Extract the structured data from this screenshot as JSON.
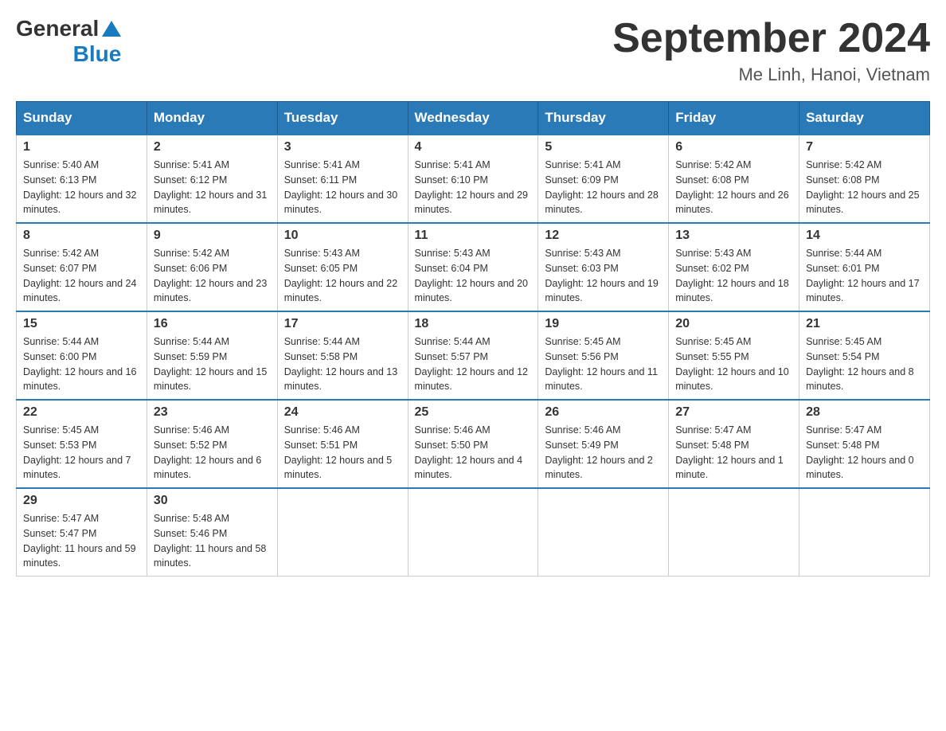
{
  "header": {
    "logo_general": "General",
    "logo_blue": "Blue",
    "month_title": "September 2024",
    "location": "Me Linh, Hanoi, Vietnam"
  },
  "days_of_week": [
    "Sunday",
    "Monday",
    "Tuesday",
    "Wednesday",
    "Thursday",
    "Friday",
    "Saturday"
  ],
  "weeks": [
    [
      {
        "day": "1",
        "sunrise": "5:40 AM",
        "sunset": "6:13 PM",
        "daylight": "12 hours and 32 minutes."
      },
      {
        "day": "2",
        "sunrise": "5:41 AM",
        "sunset": "6:12 PM",
        "daylight": "12 hours and 31 minutes."
      },
      {
        "day": "3",
        "sunrise": "5:41 AM",
        "sunset": "6:11 PM",
        "daylight": "12 hours and 30 minutes."
      },
      {
        "day": "4",
        "sunrise": "5:41 AM",
        "sunset": "6:10 PM",
        "daylight": "12 hours and 29 minutes."
      },
      {
        "day": "5",
        "sunrise": "5:41 AM",
        "sunset": "6:09 PM",
        "daylight": "12 hours and 28 minutes."
      },
      {
        "day": "6",
        "sunrise": "5:42 AM",
        "sunset": "6:08 PM",
        "daylight": "12 hours and 26 minutes."
      },
      {
        "day": "7",
        "sunrise": "5:42 AM",
        "sunset": "6:08 PM",
        "daylight": "12 hours and 25 minutes."
      }
    ],
    [
      {
        "day": "8",
        "sunrise": "5:42 AM",
        "sunset": "6:07 PM",
        "daylight": "12 hours and 24 minutes."
      },
      {
        "day": "9",
        "sunrise": "5:42 AM",
        "sunset": "6:06 PM",
        "daylight": "12 hours and 23 minutes."
      },
      {
        "day": "10",
        "sunrise": "5:43 AM",
        "sunset": "6:05 PM",
        "daylight": "12 hours and 22 minutes."
      },
      {
        "day": "11",
        "sunrise": "5:43 AM",
        "sunset": "6:04 PM",
        "daylight": "12 hours and 20 minutes."
      },
      {
        "day": "12",
        "sunrise": "5:43 AM",
        "sunset": "6:03 PM",
        "daylight": "12 hours and 19 minutes."
      },
      {
        "day": "13",
        "sunrise": "5:43 AM",
        "sunset": "6:02 PM",
        "daylight": "12 hours and 18 minutes."
      },
      {
        "day": "14",
        "sunrise": "5:44 AM",
        "sunset": "6:01 PM",
        "daylight": "12 hours and 17 minutes."
      }
    ],
    [
      {
        "day": "15",
        "sunrise": "5:44 AM",
        "sunset": "6:00 PM",
        "daylight": "12 hours and 16 minutes."
      },
      {
        "day": "16",
        "sunrise": "5:44 AM",
        "sunset": "5:59 PM",
        "daylight": "12 hours and 15 minutes."
      },
      {
        "day": "17",
        "sunrise": "5:44 AM",
        "sunset": "5:58 PM",
        "daylight": "12 hours and 13 minutes."
      },
      {
        "day": "18",
        "sunrise": "5:44 AM",
        "sunset": "5:57 PM",
        "daylight": "12 hours and 12 minutes."
      },
      {
        "day": "19",
        "sunrise": "5:45 AM",
        "sunset": "5:56 PM",
        "daylight": "12 hours and 11 minutes."
      },
      {
        "day": "20",
        "sunrise": "5:45 AM",
        "sunset": "5:55 PM",
        "daylight": "12 hours and 10 minutes."
      },
      {
        "day": "21",
        "sunrise": "5:45 AM",
        "sunset": "5:54 PM",
        "daylight": "12 hours and 8 minutes."
      }
    ],
    [
      {
        "day": "22",
        "sunrise": "5:45 AM",
        "sunset": "5:53 PM",
        "daylight": "12 hours and 7 minutes."
      },
      {
        "day": "23",
        "sunrise": "5:46 AM",
        "sunset": "5:52 PM",
        "daylight": "12 hours and 6 minutes."
      },
      {
        "day": "24",
        "sunrise": "5:46 AM",
        "sunset": "5:51 PM",
        "daylight": "12 hours and 5 minutes."
      },
      {
        "day": "25",
        "sunrise": "5:46 AM",
        "sunset": "5:50 PM",
        "daylight": "12 hours and 4 minutes."
      },
      {
        "day": "26",
        "sunrise": "5:46 AM",
        "sunset": "5:49 PM",
        "daylight": "12 hours and 2 minutes."
      },
      {
        "day": "27",
        "sunrise": "5:47 AM",
        "sunset": "5:48 PM",
        "daylight": "12 hours and 1 minute."
      },
      {
        "day": "28",
        "sunrise": "5:47 AM",
        "sunset": "5:48 PM",
        "daylight": "12 hours and 0 minutes."
      }
    ],
    [
      {
        "day": "29",
        "sunrise": "5:47 AM",
        "sunset": "5:47 PM",
        "daylight": "11 hours and 59 minutes."
      },
      {
        "day": "30",
        "sunrise": "5:48 AM",
        "sunset": "5:46 PM",
        "daylight": "11 hours and 58 minutes."
      },
      null,
      null,
      null,
      null,
      null
    ]
  ]
}
